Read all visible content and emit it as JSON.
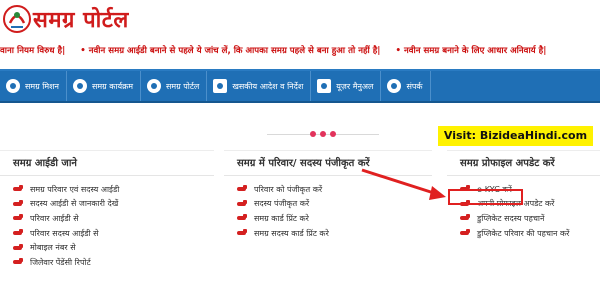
{
  "header": {
    "brand": "समग्र पोर्टल",
    "logo_name": "samagra-logo"
  },
  "ticker": {
    "items": [
      "वाना नियम विरुध है|",
      "• नवीन समग्र आईडी बनाने से पहले ये जांच लें, कि आपका समग्र पहले से बना हुआ तो नहीं है|",
      "• नवीन समग्र बनाने के लिए आधार अनिवार्य है|"
    ]
  },
  "nav": {
    "items": [
      {
        "label": "समग्र मिशन",
        "icon": "globe-icon"
      },
      {
        "label": "समग्र कार्यक्रम",
        "icon": "globe-icon"
      },
      {
        "label": "समग्र पोर्टल",
        "icon": "globe-icon"
      },
      {
        "label": "खसकीय आदेश व निर्देश",
        "icon": "document-icon"
      },
      {
        "label": "यूज़र मैनुअल",
        "icon": "book-icon"
      },
      {
        "label": "संपर्क",
        "icon": "location-icon"
      }
    ]
  },
  "badge": {
    "text": "Visit: BizideaHindi.com"
  },
  "columns": [
    {
      "title": "समग्र आईडी जाने",
      "items": [
        "समग्र परिवार एवं सदस्य आईडी",
        "सदस्य आईडी से जानकारी देखें",
        "परिवार आईडी से",
        "परिवार सदस्य आईडी से",
        "मोबाइल नंबर से",
        "जिलेवार पेंडेंसी रिपोर्ट"
      ]
    },
    {
      "title": "समग्र में परिवार/ सदस्य पंजीकृत करें",
      "items": [
        "परिवार को पंजीकृत करें",
        "सदस्य पंजीकृत करें",
        "समग्र कार्ड प्रिंट करे",
        "समग्र सदस्य कार्ड प्रिंट करे"
      ]
    },
    {
      "title": "समग्र प्रोफाइल अपडेट करें",
      "items": [
        "e-KYC करें",
        "अपनी प्रोफाइल अपडेट करें",
        "डुप्लिकेट सदस्य पहचानें",
        "डुप्लिकेट परिवार की पहचान करें"
      ]
    }
  ],
  "colors": {
    "brand_red": "#d01c1c",
    "nav_blue": "#1f6fb5",
    "badge_yellow": "#fff200",
    "highlight_red": "#e02020"
  }
}
